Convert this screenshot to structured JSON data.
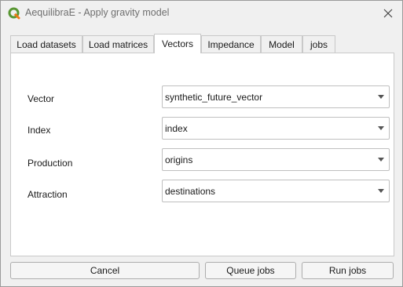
{
  "window": {
    "title": "AequilibraE - Apply gravity model",
    "app_icon": "qgis-logo-icon",
    "close_icon": "close-icon"
  },
  "tabs": [
    {
      "label": "Load datasets",
      "active": false
    },
    {
      "label": "Load matrices",
      "active": false
    },
    {
      "label": "Vectors",
      "active": true
    },
    {
      "label": "Impedance",
      "active": false
    },
    {
      "label": "Model",
      "active": false
    },
    {
      "label": "jobs",
      "active": false
    }
  ],
  "vectors": {
    "fields": [
      {
        "label": "Vector",
        "value": "synthetic_future_vector"
      },
      {
        "label": "Index",
        "value": "index"
      },
      {
        "label": "Production",
        "value": "origins"
      },
      {
        "label": "Attraction",
        "value": "destinations"
      }
    ]
  },
  "buttons": {
    "cancel": "Cancel",
    "queue_jobs": "Queue jobs",
    "run_jobs": "Run jobs"
  },
  "colors": {
    "qgis_green": "#589632",
    "qgis_yellow": "#ee7913"
  }
}
